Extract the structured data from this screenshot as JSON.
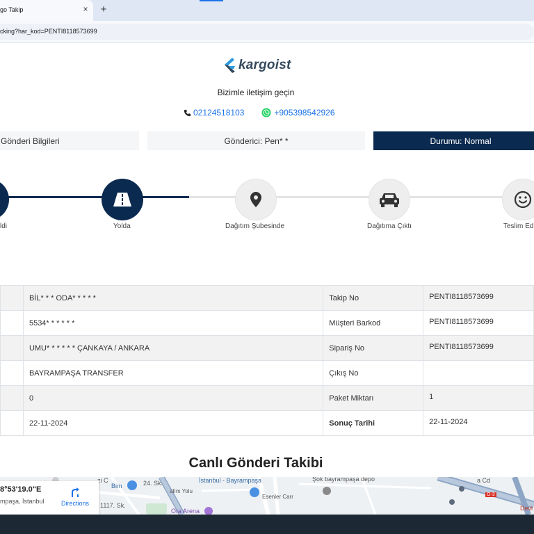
{
  "browser": {
    "tab_title": "go Takip",
    "tab_close": "×",
    "new_tab": "+",
    "url": "cking?har_kod=PENTI8118573699"
  },
  "header": {
    "logo_text": "kargoist",
    "contact_title": "Bizimle iletişim geçin",
    "phone": "02124518103",
    "whatsapp": "+905398542926"
  },
  "info_bar": {
    "left": "Gönderi Bilgileri",
    "middle": "Gönderici: Pen* *",
    "status": "Durumu: Normal"
  },
  "tracker": {
    "steps": [
      {
        "label": "ldi",
        "state": "active",
        "icon": "truck-icon"
      },
      {
        "label": "Yolda",
        "state": "active",
        "icon": "road-icon"
      },
      {
        "label": "Dağıtım Şubesinde",
        "state": "inactive",
        "icon": "map-pin-icon"
      },
      {
        "label": "Dağıtıma Çıktı",
        "state": "inactive",
        "icon": "car-icon"
      },
      {
        "label": "Teslim Ed",
        "state": "inactive",
        "icon": "smile-icon"
      }
    ],
    "colors": {
      "active": "#0b2a4f",
      "inactive": "#eeeeee",
      "line_inactive": "#e3e3e3"
    }
  },
  "details": {
    "rows": [
      {
        "value_left": "BİL* * * ODA* * * * *",
        "label": "Takip No",
        "value_right": "PENTI8118573699",
        "bold": false
      },
      {
        "value_left": "5534* * * * * *",
        "label": "Müşteri Barkod",
        "value_right": "PENTI8118573699",
        "bold": false
      },
      {
        "value_left": "UMU* * * * * * ÇANKAYA / ANKARA",
        "label": "Sipariş No",
        "value_right": "PENTI8118573699",
        "bold": false
      },
      {
        "value_left": "BAYRAMPAŞA TRANSFER",
        "label": "Çıkış No",
        "value_right": "",
        "bold": false
      },
      {
        "value_left": "0",
        "label": "Paket Miktarı",
        "value_right": "1",
        "bold": false
      },
      {
        "value_left": "22-11-2024",
        "label": "Sonuç Tarihi",
        "value_right": "22-11-2024",
        "bold": true
      }
    ]
  },
  "live": {
    "title": "Canlı Gönderi Takibi",
    "coord": "8°53'19.0\"E",
    "place": "mpaşa, İstanbul",
    "directions": "Directions",
    "labels": {
      "bim": "Bim",
      "istanbul_bayrampasa": "İstanbul - Bayrampaşa",
      "sok": "Şok bayrampaşa depo",
      "ora_arena": "Ora Arena",
      "sk_1117": "1117. Sk.",
      "sk_24": "24. Sk.",
      "esenler": "Esenler Carr",
      "yolu": "afım Yolu",
      "road_o3": "O-3",
      "cd": "a Cd",
      "zi": "zi C",
      "dev": "Devl"
    }
  }
}
